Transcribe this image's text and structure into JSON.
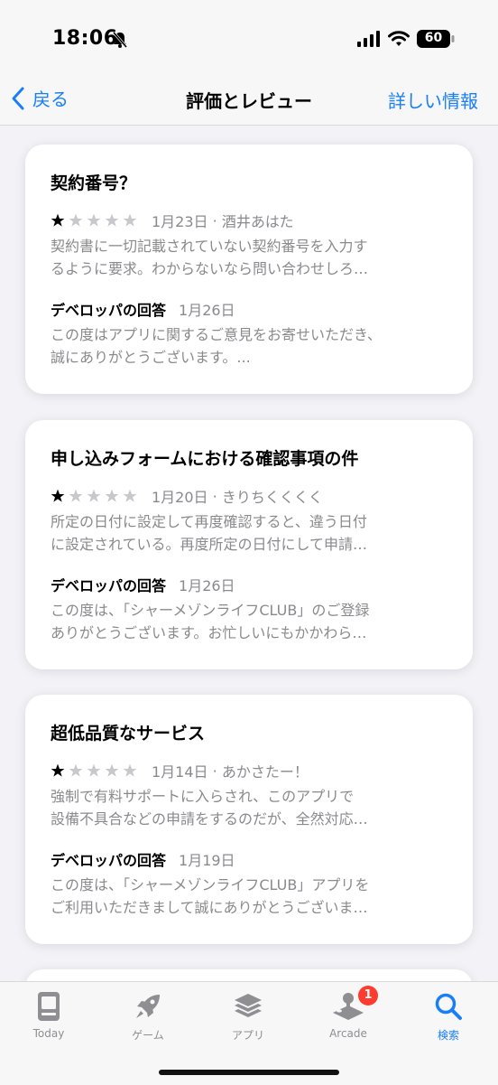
{
  "status": {
    "time": "18:06",
    "battery": "60"
  },
  "nav": {
    "back": "戻る",
    "title": "評価とレビュー",
    "more": "詳しい情報"
  },
  "reviews": [
    {
      "title": "契約番号？",
      "rating": 1,
      "date": "1月23日",
      "author": "酒井あはた",
      "body": [
        "契約書に一切記載されていない契約番号を入力す",
        "るように要求。わからないなら問い合わせしろ…"
      ],
      "dev_label": "デベロッパの回答",
      "dev_date": "1月26日",
      "reply": [
        "この度はアプリに関するご意見をお寄せいただき、",
        "誠にありがとうございます。..."
      ]
    },
    {
      "title": "申し込みフォームにおける確認事項の件",
      "rating": 1,
      "date": "1月20日",
      "author": "きりちくくくく",
      "body": [
        "所定の日付に設定して再度確認すると、違う日付",
        "に設定されている。再度所定の日付にして申請…"
      ],
      "dev_label": "デベロッパの回答",
      "dev_date": "1月26日",
      "reply": [
        "この度は、「シャーメゾンライフCLUB」のご登録",
        "ありがとうございます。お忙しいにもかかわら…"
      ]
    },
    {
      "title": "超低品質なサービス",
      "rating": 1,
      "date": "1月14日",
      "author": "あかさたー！",
      "body": [
        "強制で有料サポートに入らされ、このアプリで",
        "設備不具合などの申請をするのだが、全然対応…"
      ],
      "dev_label": "デベロッパの回答",
      "dev_date": "1月19日",
      "reply": [
        "この度は、「シャーメゾンライフCLUB」アプリを",
        "ご利用いただきまして誠にありがとうございま…"
      ]
    }
  ],
  "tabs": [
    {
      "label": "Today",
      "icon": "today-icon"
    },
    {
      "label": "ゲーム",
      "icon": "rocket-icon"
    },
    {
      "label": "アプリ",
      "icon": "layers-icon"
    },
    {
      "label": "Arcade",
      "icon": "joystick-icon",
      "badge": "1"
    },
    {
      "label": "検索",
      "icon": "search-icon",
      "active": true
    }
  ],
  "colors": {
    "accent": "#1a7ff6",
    "badge": "#ff3b30",
    "secondary_text": "#8a8a8e"
  }
}
